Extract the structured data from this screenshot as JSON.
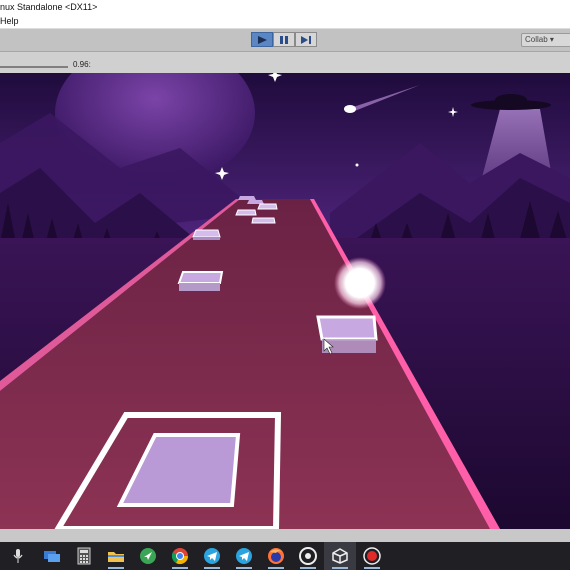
{
  "window": {
    "title": "nux Standalone <DX11>"
  },
  "menu": {
    "help_label": "Help"
  },
  "toolbar": {
    "collab_label": "Collab ▾"
  },
  "game_view": {
    "scale_value": "0.96:"
  },
  "taskbar": {
    "icons": [
      "microphone-icon",
      "network-icon",
      "calculator-icon",
      "file-explorer-icon",
      "location-app-icon",
      "chrome-icon",
      "telegram-icon",
      "telegram-icon",
      "firefox-icon",
      "media-app-icon",
      "unity-icon",
      "record-icon"
    ]
  },
  "colors": {
    "sky_top": "#2a0d4a",
    "sky_mid": "#7a3fa6",
    "road": "#7c2a4a",
    "road_edge": "#ff5ea8",
    "tile": "#b99ad6",
    "play_active": "#5b86c4"
  }
}
